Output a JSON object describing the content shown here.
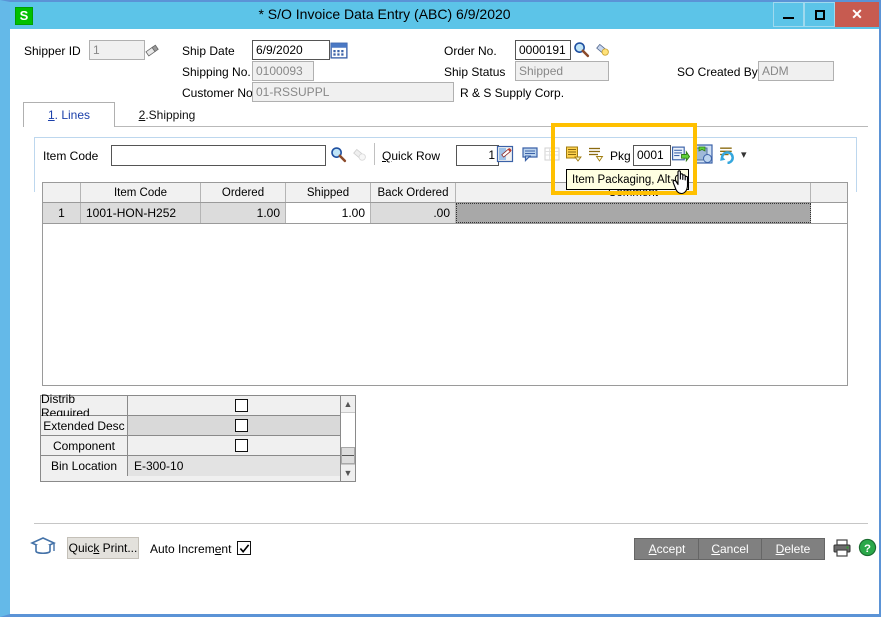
{
  "window": {
    "title": "* S/O Invoice Data Entry (ABC) 6/9/2020",
    "logo_letter": "S",
    "minimize_label": "minimize",
    "maximize_label": "maximize",
    "close_label": "✕",
    "titlebar_color": "#5cc4e8",
    "close_color": "#c75b50"
  },
  "header": {
    "shipper_id_label": "Shipper ID",
    "shipper_id_value": "1",
    "ship_date_label": "Ship Date",
    "ship_date_value": "6/9/2020",
    "shipping_no_label": "Shipping No.",
    "shipping_no_value": "0100093",
    "customer_no_label": "Customer No.",
    "customer_no_value": "01-RSSUPPL",
    "order_no_label": "Order No.",
    "order_no_value": "0000191",
    "ship_status_label": "Ship Status",
    "ship_status_value": "Shipped",
    "so_created_by_label": "SO Created By",
    "so_created_by_value": "ADM",
    "customer_name": "R & S Supply Corp."
  },
  "tabs": [
    {
      "num": "1",
      "label": ". Lines",
      "active": true
    },
    {
      "num": "2",
      "label": ".Shipping",
      "active": false
    }
  ],
  "toolbar": {
    "item_code_label": "Item Code",
    "item_code_value": "",
    "quick_row_label": "Quick Row",
    "quick_row_value": "1",
    "pkg_label": "Pkg",
    "pkg_value": "0001",
    "dropdown_arrow": "▾"
  },
  "tooltip": {
    "text": "Item Packaging, Alt-G",
    "highlight_color": "#ffc000"
  },
  "grid": {
    "columns": [
      "",
      "Item Code",
      "Ordered",
      "Shipped",
      "Back Ordered",
      "Comment",
      ""
    ],
    "rows": [
      {
        "row_number": "1",
        "item_code": "1001-HON-H252",
        "ordered": "1.00",
        "shipped": "1.00",
        "back_ordered": ".00",
        "comment": ""
      }
    ]
  },
  "detail": {
    "rows": [
      {
        "label": "Distrib Required",
        "type": "checkbox",
        "checked": false
      },
      {
        "label": "Extended Desc",
        "type": "checkbox",
        "checked": false
      },
      {
        "label": "Component",
        "type": "checkbox",
        "checked": false
      },
      {
        "label": "Bin Location",
        "type": "text",
        "value": "E-300-10"
      }
    ]
  },
  "footer": {
    "quick_print_pre": "Quic",
    "quick_print_key": "k",
    "quick_print_post": " Print...",
    "auto_increment_pre": "Auto Increm",
    "auto_increment_key": "e",
    "auto_increment_post": "nt",
    "auto_increment_checked": true,
    "accept_key": "A",
    "accept_rest": "ccept",
    "cancel_key": "C",
    "cancel_rest": "ancel",
    "delete_key": "D",
    "delete_rest": "elete"
  }
}
